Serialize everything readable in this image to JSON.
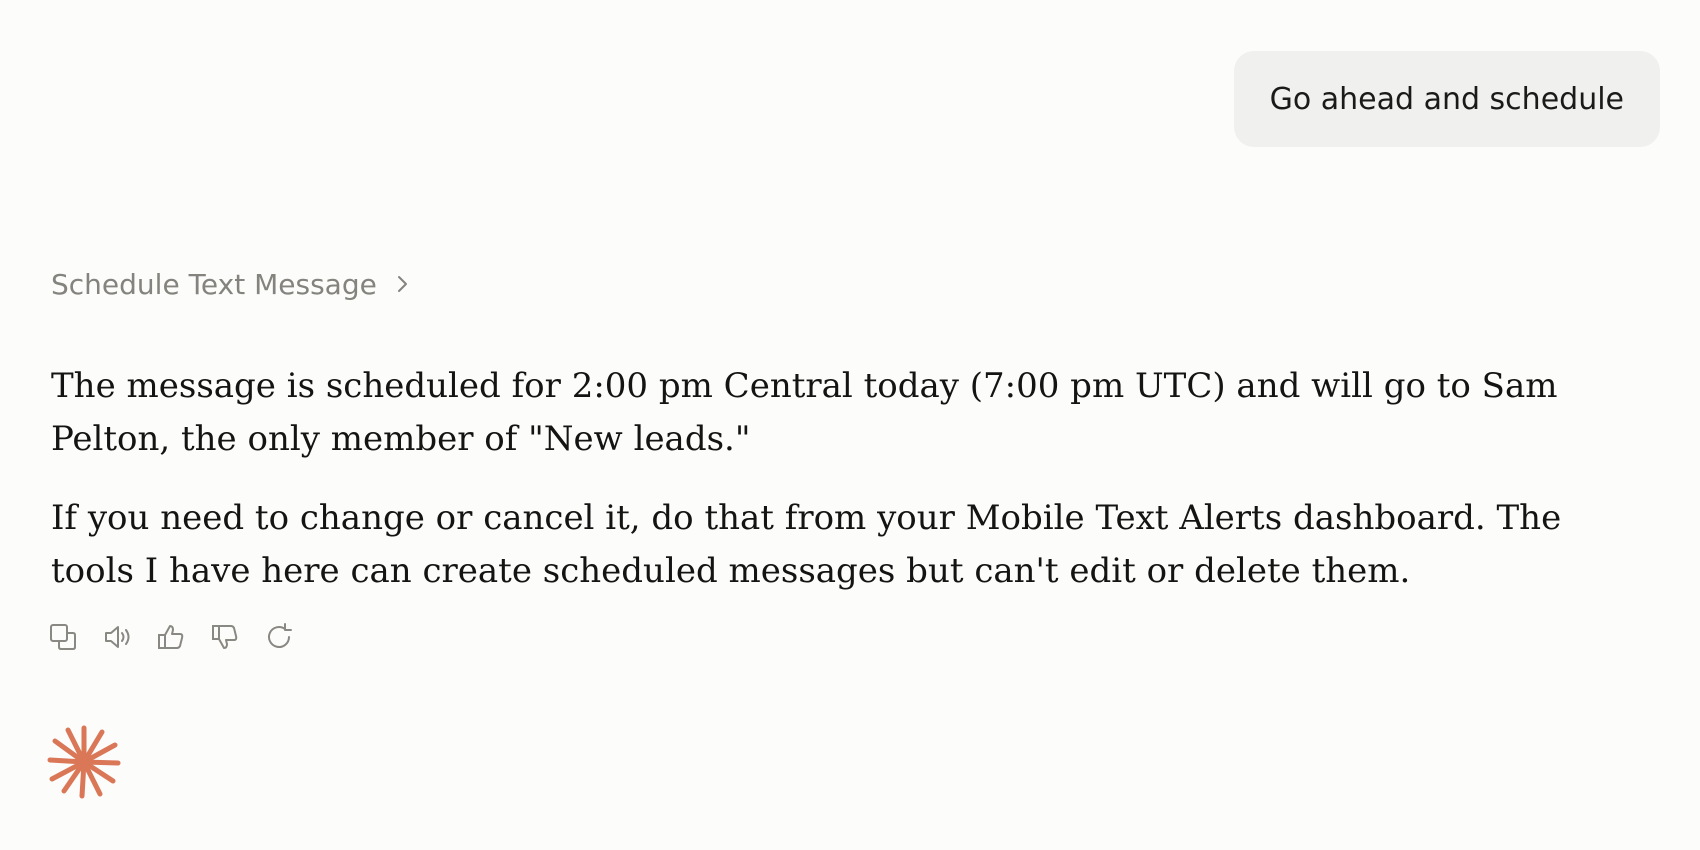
{
  "conversation": {
    "user_message": "Go ahead and schedule",
    "tool_call": {
      "label": "Schedule Text Message",
      "icon": "chevron-right-icon"
    },
    "assistant_paragraphs": [
      "The message is scheduled for 2:00 pm Central today (7:00 pm UTC) and will go to Sam Pelton, the only member of \"New leads.\"",
      "If you need to change or cancel it, do that from your Mobile Text Alerts dashboard. The tools I have here can create scheduled messages but can't edit or delete them."
    ]
  },
  "actions": [
    {
      "name": "copy",
      "icon": "copy-icon"
    },
    {
      "name": "read-aloud",
      "icon": "speaker-icon"
    },
    {
      "name": "thumbs-up",
      "icon": "thumbs-up-icon"
    },
    {
      "name": "thumbs-down",
      "icon": "thumbs-down-icon"
    },
    {
      "name": "retry",
      "icon": "retry-icon"
    }
  ],
  "colors": {
    "background": "#fcfcfb",
    "user_bubble": "#f0f0ef",
    "muted_text": "#85837e",
    "brand_accent": "#d97757"
  },
  "logo": {
    "icon": "claude-spark-icon"
  }
}
